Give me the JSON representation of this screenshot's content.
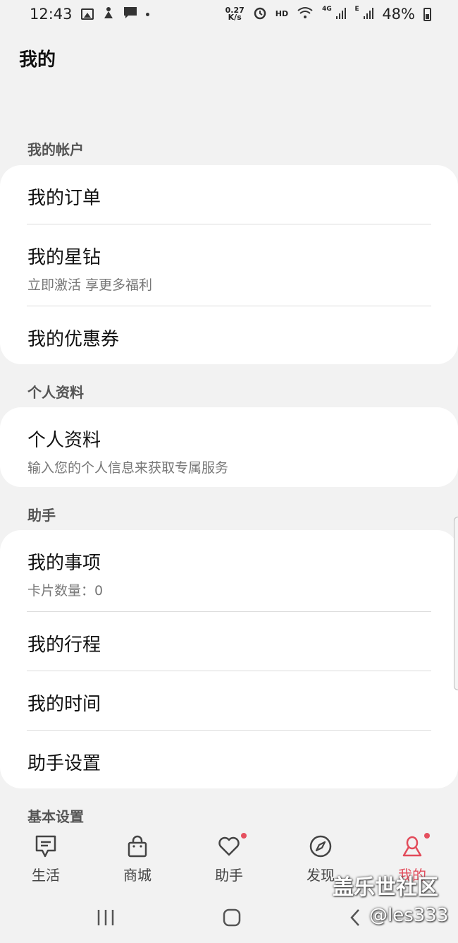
{
  "status_bar": {
    "time": "12:43",
    "net_speed_top": "0.27",
    "net_speed_bottom": "K/s",
    "hd": "HD",
    "network": "4G",
    "network_e": "E",
    "battery": "48%"
  },
  "page_title": "我的",
  "sections": {
    "account": {
      "header": "我的帐户",
      "items": [
        {
          "title": "我的订单"
        },
        {
          "title": "我的星钻",
          "subtitle": "立即激活 享更多福利"
        },
        {
          "title": "我的优惠券"
        }
      ]
    },
    "profile": {
      "header": "个人资料",
      "items": [
        {
          "title": "个人资料",
          "subtitle": "输入您的个人信息来获取专属服务"
        }
      ]
    },
    "assistant": {
      "header": "助手",
      "items": [
        {
          "title": "我的事项",
          "subtitle": "卡片数量：0"
        },
        {
          "title": "我的行程"
        },
        {
          "title": "我的时间"
        },
        {
          "title": "助手设置"
        }
      ]
    },
    "basic": {
      "header": "基本设置"
    }
  },
  "bottom_nav": [
    {
      "label": "生活",
      "icon": "bookmark-icon"
    },
    {
      "label": "商城",
      "icon": "shopping-bag-icon"
    },
    {
      "label": "助手",
      "icon": "heart-icon",
      "badge": true
    },
    {
      "label": "发现",
      "icon": "compass-icon"
    },
    {
      "label": "我的",
      "icon": "person-icon",
      "badge": true,
      "active": true
    }
  ],
  "colors": {
    "accent": "#e24b5a",
    "background": "#f2f2f2",
    "card": "#ffffff"
  },
  "watermark": {
    "text": "盖乐世社区",
    "handle": "@les333"
  }
}
